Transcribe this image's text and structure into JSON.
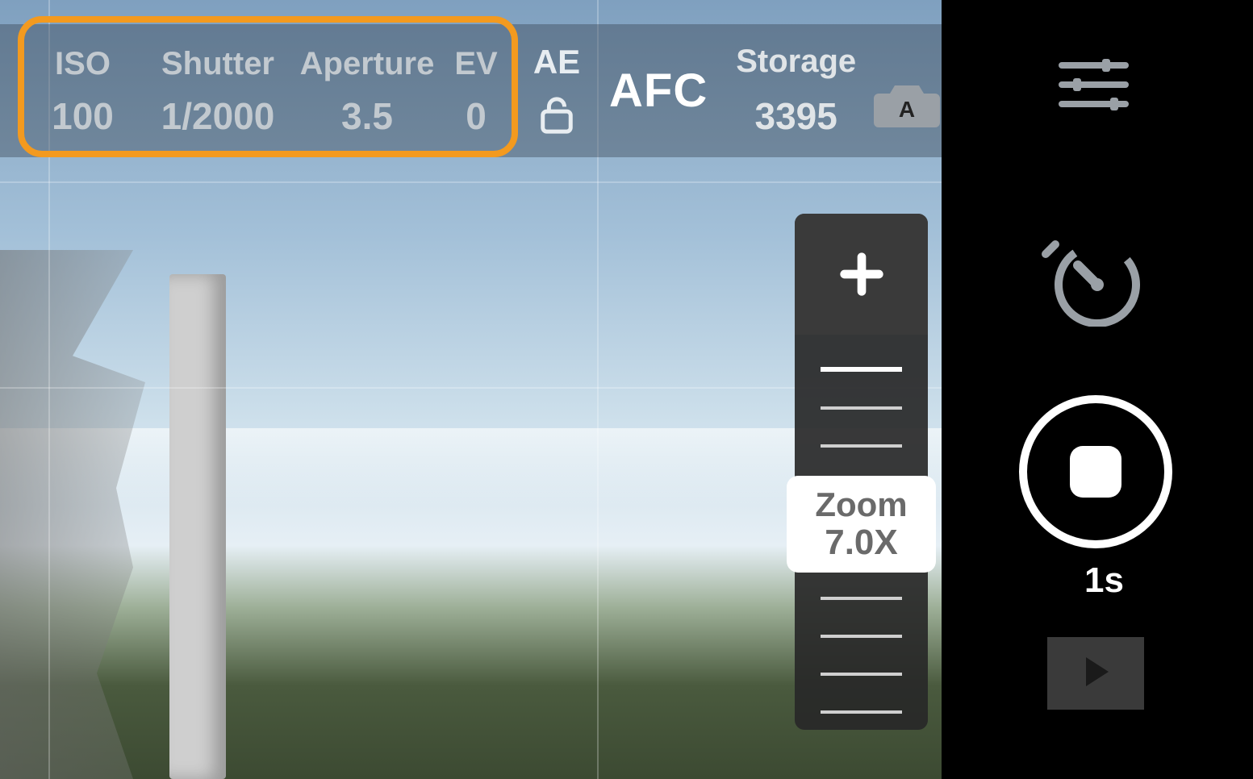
{
  "camera": {
    "iso": {
      "label": "ISO",
      "value": "100"
    },
    "shutter": {
      "label": "Shutter",
      "value": "1/2000"
    },
    "aperture": {
      "label": "Aperture",
      "value": "3.5"
    },
    "ev": {
      "label": "EV",
      "value": "0"
    },
    "ae_label": "AE",
    "afc_label": "AFC",
    "storage": {
      "label": "Storage",
      "value": "3395"
    },
    "mode_badge": "A"
  },
  "zoom": {
    "label": "Zoom",
    "value": "7.0X",
    "plus": "+"
  },
  "sidebar": {
    "elapsed": "1s"
  },
  "icons": {
    "ae_lock": "unlock-icon",
    "camera": "camera-auto-icon",
    "settings": "sliders-icon",
    "timer": "speed-timer-icon",
    "play": "play-icon"
  }
}
